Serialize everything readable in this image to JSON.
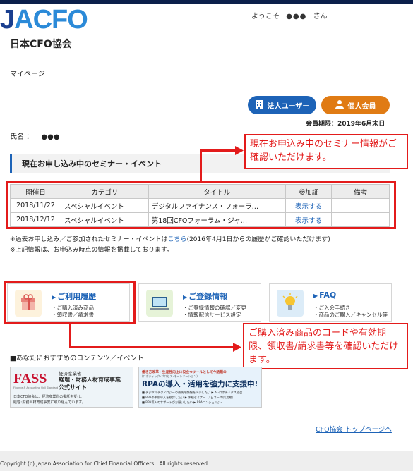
{
  "header": {
    "logo_j": "J",
    "logo_acfo": "ACFO",
    "logo_sub": "日本CFO協会",
    "welcome_prefix": "ようこそ",
    "welcome_name": "●●●",
    "welcome_suffix": "さん"
  },
  "breadcrumb": {
    "mypage": "マイページ"
  },
  "user_buttons": {
    "corporate": "法人ユーザー",
    "individual": "個人会員"
  },
  "membership": {
    "expiry": "会員期限：2019年6月末日"
  },
  "profile": {
    "name_label": "氏名 ：",
    "name_value": "●●●"
  },
  "seminars": {
    "section_title": "現在お申し込み中のセミナー・イベント",
    "columns": [
      "開催日",
      "カテゴリ",
      "タイトル",
      "参加証",
      "備考"
    ],
    "rows": [
      {
        "date": "2018/11/22",
        "category": "スペシャルイベント",
        "title": "デジタルファイナンス・フォーラ…",
        "ticket": "表示する",
        "note": ""
      },
      {
        "date": "2018/12/12",
        "category": "スペシャルイベント",
        "title": "第18回CFOフォーラム・ジャ…",
        "ticket": "表示する",
        "note": ""
      }
    ],
    "note1_a": "※過去お申し込み／ご参加されたセミナー・イベントは",
    "note1_link": "こちら",
    "note1_b": "(2016年4月1日からの履歴がご確認いただけます)",
    "note2": "※上記情報は、お申込み時点の情報を掲載しております。"
  },
  "callouts": {
    "seminar": "現在お申込み中のセミナー情報がご確認いただけます。",
    "purchase": "ご購入済み商品のコードや有効期限、領収書/請求書等を確認いただけます。"
  },
  "cards": [
    {
      "title": "ご利用履歴",
      "lines": [
        "・ご購入済み商品",
        "・領収書／請求書"
      ]
    },
    {
      "title": "ご登録情報",
      "lines": [
        "・ご登録情報の確認／変更",
        "・情報配信サービス設定"
      ]
    },
    {
      "title": "FAQ",
      "lines": [
        "・ご入会手続き",
        "・商品のご購入／キャンセル等"
      ]
    }
  ],
  "recommend": {
    "title": "■あなたにおすすめのコンテンツ／イベント"
  },
  "banners": {
    "fass_logo": "FASS",
    "fass_tagline": "Finance & Accounting Skill Standard",
    "fass_title_1": "経済産業省",
    "fass_title_2": "経理・財務人材育成事業",
    "fass_title_3": "公式サイト",
    "fass_desc_1": "日本CFO協会は、経済産業省の委託を受け、",
    "fass_desc_2": "経理･財務人材育成事業に取り組んでいます。",
    "rpa_top": "働き方改革・生産性向上に役立つツールとして今話題の",
    "rpa_sub": "(ロボティック･プロセス･オートメーション)",
    "rpa_main": "RPAの導入・活用を強力に支援中!",
    "rpa_b1": "デジタルテクノロジーの最先端情報を入手したい",
    "rpa_b1r": "AI･ロボティクス協会",
    "rpa_b2": "RPAの午前導入を検討したい",
    "rpa_b2r": "体験セミナー（1日コース/応用編）",
    "rpa_b3": "RPA導入のサポートがお願いしたい",
    "rpa_b3r": "RPAコンシェルジュ"
  },
  "links": {
    "top_page": "CFO協会 トップページへ"
  },
  "footer": {
    "copyright": "Copyright (c) Japan Association for Chief Financial Officers . All rights reserved."
  },
  "colors": {
    "brand_blue": "#1d63b7",
    "orange": "#e07b14",
    "highlight_red": "#e31b1b"
  }
}
